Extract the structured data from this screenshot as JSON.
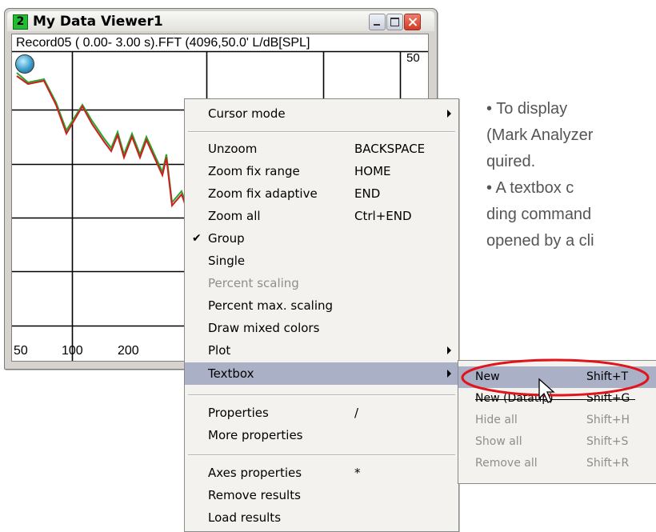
{
  "window": {
    "number": "2",
    "title": "My Data Viewer1",
    "plot_header": "Record05 ( 0.00- 3.00 s).FFT (4096,50.0' L/dB[SPL]",
    "y_tick_top": "50",
    "x_ticks": [
      "50",
      "100",
      "200"
    ]
  },
  "chart_data": {
    "type": "line",
    "xlabel": "",
    "ylabel": "L/dB[SPL]",
    "x_ticks": [
      "50",
      "100",
      "200"
    ],
    "y_ticks": [
      "50"
    ],
    "x_scale": "log",
    "grid": true,
    "series": [
      {
        "color": "#cc1f1f",
        "values": []
      },
      {
        "color": "#2aa52a",
        "values": []
      }
    ]
  },
  "context_menu": {
    "items": [
      {
        "label": "Cursor mode",
        "submenu": true
      },
      {
        "separator": true
      },
      {
        "label": "Unzoom",
        "shortcut": "BACKSPACE"
      },
      {
        "label": "Zoom fix range",
        "shortcut": "HOME"
      },
      {
        "label": "Zoom fix adaptive",
        "shortcut": "END"
      },
      {
        "label": "Zoom all",
        "shortcut": "Ctrl+END"
      },
      {
        "label": "Group",
        "checked": true
      },
      {
        "label": "Single"
      },
      {
        "label": "Percent scaling",
        "disabled": true
      },
      {
        "label": "Percent max. scaling"
      },
      {
        "label": "Draw mixed colors"
      },
      {
        "label": "Plot",
        "submenu": true
      },
      {
        "label": "Textbox",
        "submenu": true,
        "highlighted": true
      },
      {
        "separator": true
      },
      {
        "label": "Properties",
        "shortcut": "/"
      },
      {
        "label": "More properties"
      },
      {
        "separator": true
      },
      {
        "label": "Axes properties",
        "shortcut": "*"
      },
      {
        "label": "Remove results"
      },
      {
        "label": "Load results"
      }
    ]
  },
  "submenu": {
    "items": [
      {
        "label": "New",
        "shortcut": "Shift+T",
        "highlighted": true
      },
      {
        "label": "New (Datatip)",
        "shortcut": "Shift+G",
        "struck": true
      },
      {
        "label": "Hide all",
        "shortcut": "Shift+H",
        "disabled": true
      },
      {
        "label": "Show all",
        "shortcut": "Shift+S",
        "disabled": true
      },
      {
        "label": "Remove all",
        "shortcut": "Shift+R",
        "disabled": true
      }
    ]
  },
  "side_text": {
    "lines": [
      "•  To  display",
      "(Mark Analyzer",
      "quired.",
      "•  A textbox c",
      "ding command",
      "opened by a cli"
    ]
  },
  "colors": {
    "highlight": "#aab0c6",
    "annotation_ellipse": "#e0141a"
  }
}
